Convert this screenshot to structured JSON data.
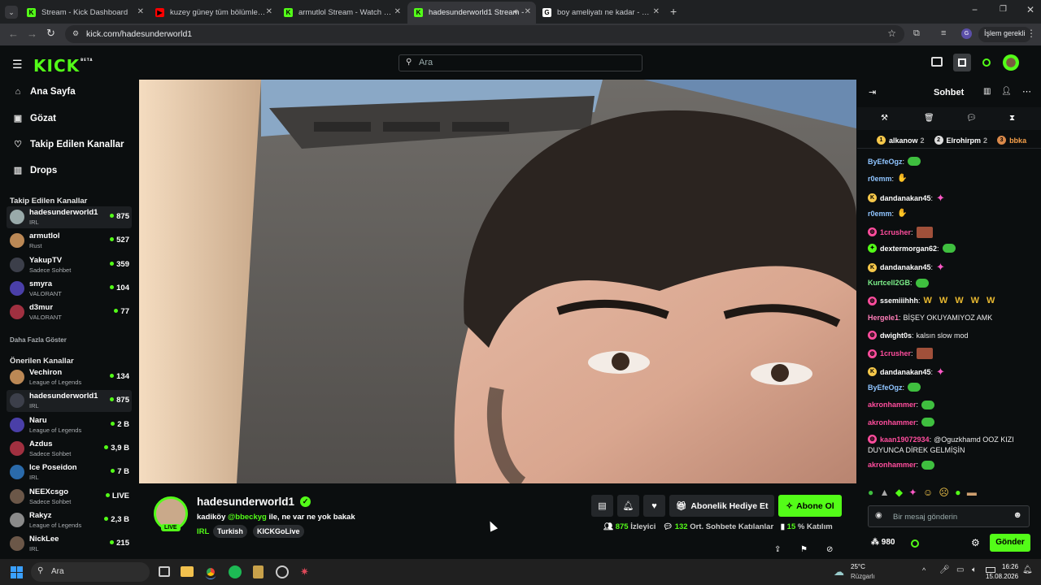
{
  "colors": {
    "accent": "#53fc18",
    "sidebar_bg": "#0b0e0f",
    "tab_bg": "#35363a"
  },
  "browser": {
    "tabs": [
      {
        "title": "Stream - Kick Dashboard",
        "icon": "kick-icon",
        "active": false
      },
      {
        "title": "kuzey güney tüm bölümler - Yo",
        "icon": "youtube-icon",
        "active": false
      },
      {
        "title": "armutlol Stream - Watch Live o",
        "icon": "kick-icon",
        "active": false
      },
      {
        "title": "hadesunderworld1 Stream -",
        "icon": "kick-icon",
        "active": true
      },
      {
        "title": "boy ameliyatı ne kadar - Googl",
        "icon": "google-icon",
        "active": false
      }
    ],
    "url": "kick.com/hadesunderworld1",
    "profile_label": "İşlem gerekli"
  },
  "header": {
    "logo": "KICK",
    "logo_badge": "BETA",
    "search_placeholder": "Ara"
  },
  "sidebar": {
    "nav": [
      {
        "label": "Ana Sayfa",
        "icon": "home-icon"
      },
      {
        "label": "Gözat",
        "icon": "browse-icon"
      },
      {
        "label": "Takip Edilen Kanallar",
        "icon": "heart-icon"
      },
      {
        "label": "Drops",
        "icon": "drops-icon"
      }
    ],
    "followed_title": "Takip Edilen Kanallar",
    "followed": [
      {
        "name": "hadesunderworld1",
        "sub": "IRL",
        "viewers": "875"
      },
      {
        "name": "armutlol",
        "sub": "Rust",
        "viewers": "527"
      },
      {
        "name": "YakupTV",
        "sub": "Sadece Sohbet",
        "viewers": "359"
      },
      {
        "name": "smyra",
        "sub": "VALORANT",
        "viewers": "104"
      },
      {
        "name": "d3mur",
        "sub": "VALORANT",
        "viewers": "77"
      }
    ],
    "show_more": "Daha Fazla Göster",
    "recommended_title": "Önerilen Kanallar",
    "recommended": [
      {
        "name": "Vechiron",
        "sub": "League of Legends",
        "viewers": "134"
      },
      {
        "name": "hadesunderworld1",
        "sub": "IRL",
        "viewers": "875"
      },
      {
        "name": "Naru",
        "sub": "League of Legends",
        "viewers": "2 B"
      },
      {
        "name": "Azdus",
        "sub": "Sadece Sohbet",
        "viewers": "3,9 B"
      },
      {
        "name": "Ice Poseidon",
        "sub": "IRL",
        "viewers": "7 B"
      },
      {
        "name": "NEEXcsgo",
        "sub": "Sadece Sohbet",
        "viewers": "LIVE"
      },
      {
        "name": "Rakyz",
        "sub": "League of Legends",
        "viewers": "2,3 B"
      },
      {
        "name": "NickLee",
        "sub": "IRL",
        "viewers": "215"
      }
    ]
  },
  "stream": {
    "channel": "hadesunderworld1",
    "live_badge": "LIVE",
    "title_prefix": "kadiköy ",
    "title_mention": "@bbeckyg",
    "title_suffix": " ile, ne var ne yok bakak",
    "category": "IRL",
    "tags": [
      "Turkish",
      "KICKGoLive"
    ],
    "gift_label": "Abonelik Hediye Et",
    "subscribe_label": "Abone Ol",
    "viewers": "875",
    "viewers_label": "İzleyici",
    "chatters": "132",
    "chatters_label": "Ort. Sohbete Katılanlar",
    "participation": "15",
    "participation_label": "% Katılım"
  },
  "chat": {
    "title": "Sohbet",
    "leaderboard": [
      {
        "rank": "1",
        "name": "alkanow",
        "count": "2"
      },
      {
        "rank": "2",
        "name": "Elrohirpm",
        "count": "2"
      },
      {
        "rank": "3",
        "name": "bbka",
        "count": ""
      }
    ],
    "messages": [
      {
        "user": "ByEfeOgz",
        "color": "#8fc4ff",
        "text": "",
        "emote": "pepe"
      },
      {
        "user": "r0emm",
        "color": "#8fc4ff",
        "text": "",
        "emote": "hands"
      },
      {
        "user": "dandanakan45",
        "color": "#ffffff",
        "text": "",
        "emote": "pink",
        "badge": "K"
      },
      {
        "user": "r0emm",
        "color": "#8fc4ff",
        "text": "",
        "emote": "hands"
      },
      {
        "user": "1crusher",
        "color": "#ff4d9d",
        "text": "",
        "emote": "face",
        "badge": "s"
      },
      {
        "user": "dextermorgan62",
        "color": "#ffffff",
        "text": "",
        "emote": "pepe",
        "badge": "g"
      },
      {
        "user": "dandanakan45",
        "color": "#ffffff",
        "text": "",
        "emote": "pink",
        "badge": "K"
      },
      {
        "user": "Kurtcell2GB",
        "color": "#7cf08a",
        "text": "",
        "emote": "pepe"
      },
      {
        "user": "ssemiiihhh",
        "color": "#ffffff",
        "text": "",
        "emote": "W",
        "badge": "s"
      },
      {
        "user": "Hergele1",
        "color": "#ff7db8",
        "text": "BİŞEY OKUYAMIYOZ AMK"
      },
      {
        "user": "dwight0s",
        "color": "#ffffff",
        "text": "kalsın slow mod",
        "badge": "s"
      },
      {
        "user": "1crusher",
        "color": "#ff4d9d",
        "text": "",
        "emote": "face",
        "badge": "s"
      },
      {
        "user": "dandanakan45",
        "color": "#ffffff",
        "text": "",
        "emote": "pink",
        "badge": "K"
      },
      {
        "user": "ByEfeOgz",
        "color": "#8fc4ff",
        "text": "",
        "emote": "pepe"
      },
      {
        "user": "akronhammer",
        "color": "#ff4d9d",
        "text": "",
        "emote": "pepe"
      },
      {
        "user": "akronhammer",
        "color": "#ff4d9d",
        "text": "",
        "emote": "pepe"
      },
      {
        "user": "kaan19072934",
        "color": "#ff4d9d",
        "text": "@Oguzkhamd OOZ KIZI",
        "text2": "DUYUNCA DİREK GELMİŞİN",
        "badge": "s"
      },
      {
        "user": "akronhammer",
        "color": "#ff4d9d",
        "text": "",
        "emote": "pepe"
      }
    ],
    "input_placeholder": "Bir mesaj gönderin",
    "points": "980",
    "send_label": "Gönder"
  },
  "taskbar": {
    "search_placeholder": "Ara",
    "weather_temp": "25°C",
    "weather_desc": "Rüzgarlı",
    "time": "16:26",
    "date": "15.08.2026"
  }
}
